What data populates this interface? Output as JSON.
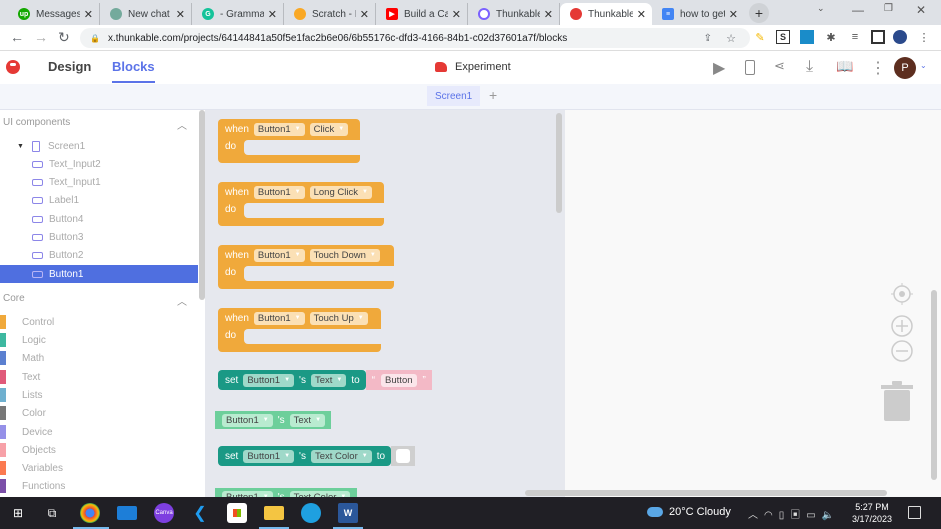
{
  "browser": {
    "tabs": [
      {
        "title": "Messages",
        "icon": "upwork-icon",
        "color": "#14a800",
        "active": false
      },
      {
        "title": "New chat",
        "icon": "chatgpt-icon",
        "color": "#74aa9c",
        "active": false
      },
      {
        "title": "- Grammarly",
        "icon": "grammarly-icon",
        "color": "#15c39a",
        "active": false
      },
      {
        "title": "Scratch - Im",
        "icon": "scratch-icon",
        "color": "#f9a825",
        "active": false
      },
      {
        "title": "Build a Calc",
        "icon": "youtube-icon",
        "color": "#ff0000",
        "active": false
      },
      {
        "title": "Thunkable",
        "icon": "thunkable-c-icon",
        "color": "#7b61ff",
        "active": false
      },
      {
        "title": "Thunkable",
        "icon": "thunkable-icon",
        "color": "#e53935",
        "active": true
      },
      {
        "title": "how to get",
        "icon": "google-docs-icon",
        "color": "#4285f4",
        "active": false
      }
    ],
    "url": "x.thunkable.com/projects/64144841a50f5e1fac2b6e06/6b55176c-dfd3-4166-84b1-c02d37601a7f/blocks"
  },
  "app": {
    "nav": {
      "design": "Design",
      "blocks": "Blocks"
    },
    "project_name": "Experiment",
    "avatar_letter": "P",
    "screen_tab": "Screen1",
    "add_screen": "+"
  },
  "sidebar": {
    "ui_header": "UI components",
    "tree": [
      {
        "label": "Screen1",
        "type": "screen",
        "selected": false
      },
      {
        "label": "Text_Input2",
        "type": "text-input",
        "selected": false
      },
      {
        "label": "Text_Input1",
        "type": "text-input",
        "selected": false
      },
      {
        "label": "Label1",
        "type": "label",
        "selected": false
      },
      {
        "label": "Button4",
        "type": "button",
        "selected": false
      },
      {
        "label": "Button3",
        "type": "button",
        "selected": false
      },
      {
        "label": "Button2",
        "type": "button",
        "selected": false
      },
      {
        "label": "Button1",
        "type": "button",
        "selected": true
      }
    ],
    "core_header": "Core",
    "core": [
      {
        "label": "Control",
        "color": "#f0a93b"
      },
      {
        "label": "Logic",
        "color": "#3db8a0"
      },
      {
        "label": "Math",
        "color": "#5b80d0"
      },
      {
        "label": "Text",
        "color": "#e05a7a"
      },
      {
        "label": "Lists",
        "color": "#6fb0cf"
      },
      {
        "label": "Color",
        "color": "#777777"
      },
      {
        "label": "Device",
        "color": "#9590e8"
      },
      {
        "label": "Objects",
        "color": "#f7a1a8"
      },
      {
        "label": "Variables",
        "color": "#fb7a50"
      },
      {
        "label": "Functions",
        "color": "#7b4fa8"
      }
    ]
  },
  "palette": {
    "events": [
      {
        "when": "when",
        "component": "Button1",
        "event": "Click",
        "do": "do"
      },
      {
        "when": "when",
        "component": "Button1",
        "event": "Long Click",
        "do": "do"
      },
      {
        "when": "when",
        "component": "Button1",
        "event": "Touch Down",
        "do": "do"
      },
      {
        "when": "when",
        "component": "Button1",
        "event": "Touch Up",
        "do": "do"
      }
    ],
    "set_text": {
      "set": "set",
      "component": "Button1",
      "possessive": "'s",
      "property": "Text",
      "to": "to",
      "open_quote": "“",
      "value": "Button",
      "close_quote": "”"
    },
    "get_text": {
      "component": "Button1",
      "possessive": "'s",
      "property": "Text"
    },
    "set_color": {
      "set": "set",
      "component": "Button1",
      "possessive": "'s",
      "property": "Text Color",
      "to": "to",
      "color_value": "#ffffff"
    },
    "get_color": {
      "component": "Button1",
      "possessive": "'s",
      "property": "Text Color"
    }
  },
  "taskbar": {
    "weather": "20°C  Cloudy",
    "time": "5:27 PM",
    "date": "3/17/2023"
  }
}
